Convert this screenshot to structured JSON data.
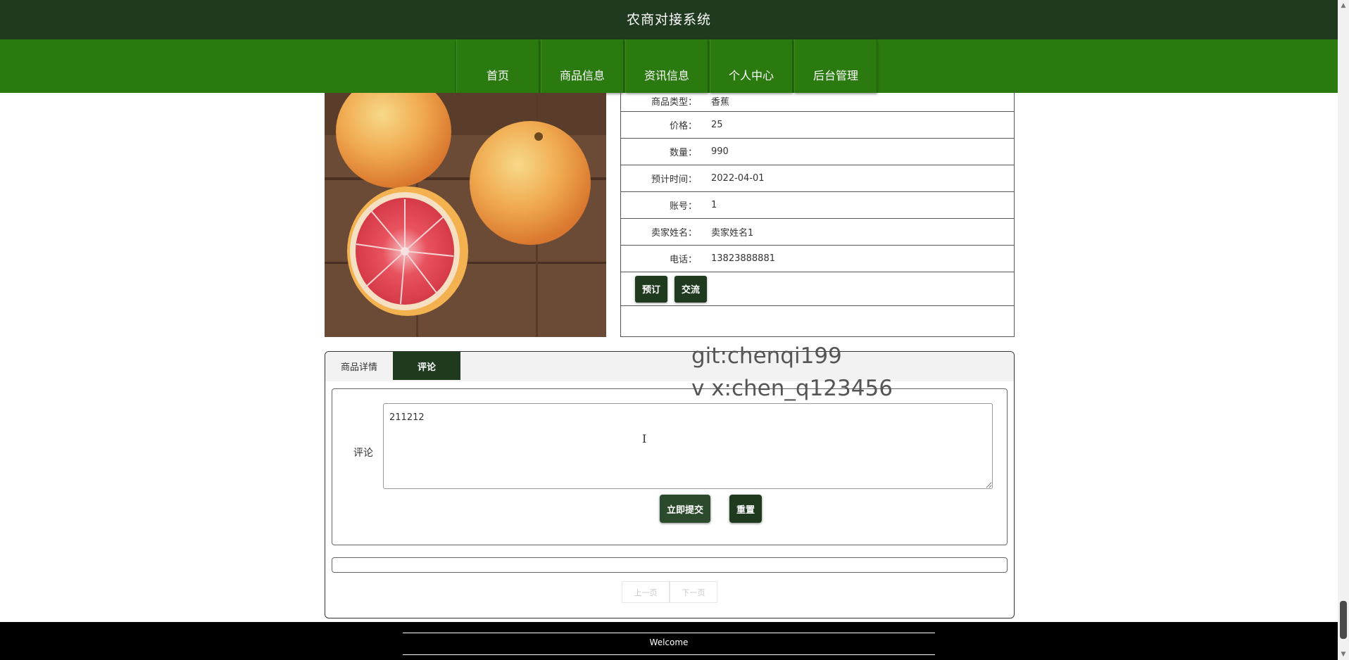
{
  "app": {
    "title": "农商对接系统"
  },
  "nav": {
    "items": [
      {
        "label": "首页"
      },
      {
        "label": "商品信息"
      },
      {
        "label": "资讯信息"
      },
      {
        "label": "个人中心"
      },
      {
        "label": "后台管理"
      }
    ]
  },
  "product": {
    "image_icon": "grapefruit-photo",
    "fields": [
      {
        "label": "商品类型：",
        "value": "香蕉"
      },
      {
        "label": "价格：",
        "value": "25"
      },
      {
        "label": "数量：",
        "value": "990"
      },
      {
        "label": "预计时间：",
        "value": "2022-04-01"
      },
      {
        "label": "账号：",
        "value": "1"
      },
      {
        "label": "卖家姓名：",
        "value": "卖家姓名1"
      },
      {
        "label": "电话：",
        "value": "13823888881"
      }
    ],
    "buttons": {
      "reserve": "预订",
      "chat": "交流"
    }
  },
  "tabs": [
    {
      "label": "商品详情",
      "active": false
    },
    {
      "label": "评论",
      "active": true
    }
  ],
  "comment_form": {
    "label": "评论",
    "value": "211212",
    "submit_label": "立即提交",
    "reset_label": "重置"
  },
  "pager": {
    "prev_label": "上一页",
    "next_label": "下一页"
  },
  "watermark": {
    "line1": "git:chenqi199",
    "line2": "v x:chen_q123456"
  },
  "footer": {
    "text": "Welcome"
  },
  "colors": {
    "header_bg": "#1f3a1f",
    "nav_bg": "#2a7a10",
    "button_dark": "#1f3a1f"
  }
}
